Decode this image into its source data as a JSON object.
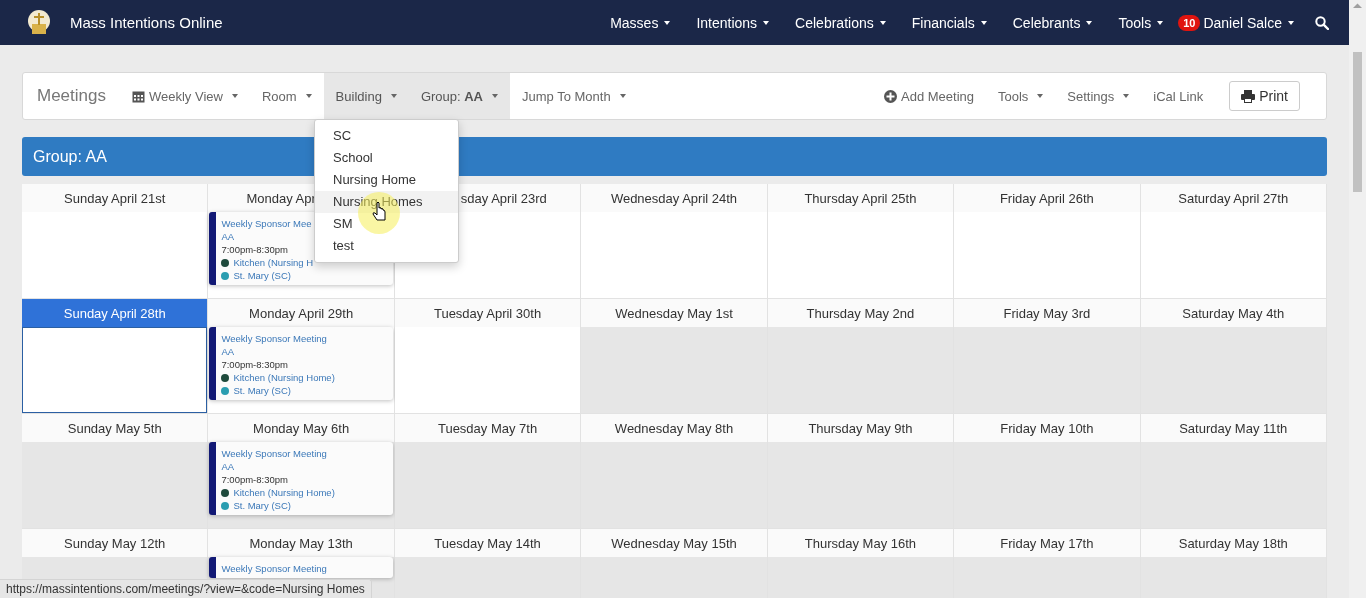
{
  "app": {
    "title": "Mass Intentions Online"
  },
  "nav": [
    {
      "label": "Masses"
    },
    {
      "label": "Intentions"
    },
    {
      "label": "Celebrations"
    },
    {
      "label": "Financials"
    },
    {
      "label": "Celebrants"
    },
    {
      "label": "Tools"
    }
  ],
  "user": {
    "badge": "10",
    "name": "Daniel Salce"
  },
  "toolbar": {
    "title": "Meetings",
    "left": [
      {
        "label": "Weekly View",
        "kind": "view",
        "active": false
      },
      {
        "label": "Room",
        "kind": "menu",
        "active": false
      },
      {
        "label": "Building",
        "kind": "menu",
        "active": true
      },
      {
        "label": "Group: **AA**",
        "kind": "menu",
        "active": true
      },
      {
        "label": "Jump To Month",
        "kind": "menu",
        "active": false
      }
    ],
    "right": [
      {
        "label": "Add Meeting",
        "kind": "add"
      },
      {
        "label": "Tools",
        "kind": "menu"
      },
      {
        "label": "Settings",
        "kind": "menu"
      },
      {
        "label": "iCal Link",
        "kind": "link"
      }
    ],
    "print": "Print"
  },
  "dropdown": {
    "items": [
      {
        "label": "SC",
        "highlighted": false
      },
      {
        "label": "School",
        "highlighted": false
      },
      {
        "label": "Nursing Home",
        "highlighted": false
      },
      {
        "label": "Nursing Homes",
        "highlighted": true
      },
      {
        "label": "SM",
        "highlighted": false
      },
      {
        "label": "test",
        "highlighted": false
      }
    ]
  },
  "banner": "Group: AA",
  "weeks": [
    {
      "days": [
        {
          "label": "Sunday April 21st",
          "shaded": false,
          "selected": false
        },
        {
          "label": "Monday Apr",
          "shaded": false,
          "selected": false,
          "events": [
            {
              "title": "Weekly Sponsor Mee",
              "group": "AA",
              "time": "7:00pm-8:30pm",
              "rooms": [
                {
                  "name": "Kitchen (Nursing H",
                  "color": "#1e4a3c"
                },
                {
                  "name": "St. Mary (SC)",
                  "color": "#2a9db0"
                }
              ]
            }
          ]
        },
        {
          "label": "sday April 23rd",
          "shaded": false,
          "selected": false
        },
        {
          "label": "Wednesday April 24th",
          "shaded": false,
          "selected": false
        },
        {
          "label": "Thursday April 25th",
          "shaded": false,
          "selected": false
        },
        {
          "label": "Friday April 26th",
          "shaded": false,
          "selected": false
        },
        {
          "label": "Saturday April 27th",
          "shaded": false,
          "selected": false
        }
      ]
    },
    {
      "days": [
        {
          "label": "Sunday April 28th",
          "shaded": false,
          "selected": true
        },
        {
          "label": "Monday April 29th",
          "shaded": false,
          "selected": false,
          "events": [
            {
              "title": "Weekly Sponsor Meeting",
              "group": "AA",
              "time": "7:00pm-8:30pm",
              "rooms": [
                {
                  "name": "Kitchen (Nursing Home)",
                  "color": "#1e4a3c"
                },
                {
                  "name": "St. Mary (SC)",
                  "color": "#2a9db0"
                }
              ]
            }
          ]
        },
        {
          "label": "Tuesday April 30th",
          "shaded": false,
          "selected": false
        },
        {
          "label": "Wednesday May 1st",
          "shaded": true,
          "selected": false
        },
        {
          "label": "Thursday May 2nd",
          "shaded": true,
          "selected": false
        },
        {
          "label": "Friday May 3rd",
          "shaded": true,
          "selected": false
        },
        {
          "label": "Saturday May 4th",
          "shaded": true,
          "selected": false
        }
      ]
    },
    {
      "days": [
        {
          "label": "Sunday May 5th",
          "shaded": true,
          "selected": false
        },
        {
          "label": "Monday May 6th",
          "shaded": true,
          "selected": false,
          "events": [
            {
              "title": "Weekly Sponsor Meeting",
              "group": "AA",
              "time": "7:00pm-8:30pm",
              "rooms": [
                {
                  "name": "Kitchen (Nursing Home)",
                  "color": "#1e4a3c"
                },
                {
                  "name": "St. Mary (SC)",
                  "color": "#2a9db0"
                }
              ]
            }
          ]
        },
        {
          "label": "Tuesday May 7th",
          "shaded": true,
          "selected": false
        },
        {
          "label": "Wednesday May 8th",
          "shaded": true,
          "selected": false
        },
        {
          "label": "Thursday May 9th",
          "shaded": true,
          "selected": false
        },
        {
          "label": "Friday May 10th",
          "shaded": true,
          "selected": false
        },
        {
          "label": "Saturday May 11th",
          "shaded": true,
          "selected": false
        }
      ]
    },
    {
      "days": [
        {
          "label": "Sunday May 12th",
          "shaded": true,
          "selected": false
        },
        {
          "label": "Monday May 13th",
          "shaded": true,
          "selected": false,
          "events": [
            {
              "title": "Weekly Sponsor Meeting"
            }
          ]
        },
        {
          "label": "Tuesday May 14th",
          "shaded": true,
          "selected": false
        },
        {
          "label": "Wednesday May 15th",
          "shaded": true,
          "selected": false
        },
        {
          "label": "Thursday May 16th",
          "shaded": true,
          "selected": false
        },
        {
          "label": "Friday May 17th",
          "shaded": true,
          "selected": false
        },
        {
          "label": "Saturday May 18th",
          "shaded": true,
          "selected": false
        }
      ]
    }
  ],
  "status_url": "https://massintentions.com/meetings/?view=&code=Nursing Homes"
}
